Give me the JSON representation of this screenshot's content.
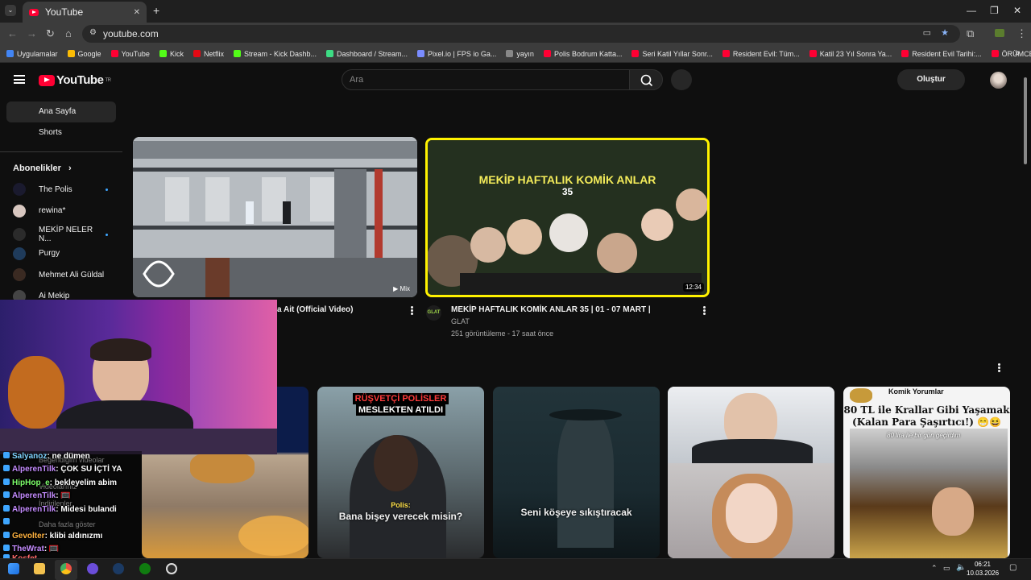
{
  "browser": {
    "tab_title": "YouTube",
    "new_tab": "+",
    "url": "youtube.com",
    "minimize": "—",
    "restore": "❐",
    "close": "✕",
    "bookmarks": [
      {
        "label": "Uygulamalar",
        "color": "#4285f4"
      },
      {
        "label": "Google",
        "color": "#fbbc05"
      },
      {
        "label": "YouTube",
        "color": "#ff0033"
      },
      {
        "label": "Kick",
        "color": "#53fc18"
      },
      {
        "label": "Netflix",
        "color": "#e50914"
      },
      {
        "label": "Stream - Kick Dashb...",
        "color": "#53fc18"
      },
      {
        "label": "Dashboard / Stream...",
        "color": "#3ddc84"
      },
      {
        "label": "Pixel.io | FPS io Ga...",
        "color": "#7a8cff"
      },
      {
        "label": "yayın",
        "color": "#888888"
      },
      {
        "label": "Polis Bodrum Katta...",
        "color": "#ff0033"
      },
      {
        "label": "Seri Katil Yıllar Sonr...",
        "color": "#ff0033"
      },
      {
        "label": "Resident Evil: Tüm...",
        "color": "#ff0033"
      },
      {
        "label": "Katil 23 Yıl Sonra Ya...",
        "color": "#ff0033"
      },
      {
        "label": "Resident Evil Tarihi:...",
        "color": "#ff0033"
      },
      {
        "label": "ÖRÜMCEK ADAM H...",
        "color": "#ff0033"
      }
    ]
  },
  "youtube": {
    "logo_text": "YouTube",
    "logo_sup": "TR",
    "search_placeholder": "Ara",
    "create_label": "Oluştur",
    "sidebar": {
      "home": "Ana Sayfa",
      "shorts": "Shorts",
      "subscriptions_header": "Abonelikler",
      "subscriptions": [
        {
          "name": "The Polis",
          "color": "#1a1a2e",
          "new": true
        },
        {
          "name": "rewina*",
          "color": "#d8c7c0",
          "new": false
        },
        {
          "name": "MEKİP NELER N...",
          "color": "#2b2b2b",
          "new": true
        },
        {
          "name": "Purgy",
          "color": "#1f3b5b",
          "new": false
        },
        {
          "name": "Mehmet Ali Güldal",
          "color": "#3a2a22",
          "new": false
        },
        {
          "name": "Ai Mekip",
          "color": "#444444",
          "new": false
        }
      ]
    },
    "videos": [
      {
        "title": "a Ait (Official Video)",
        "badge": "Mix"
      },
      {
        "title": "MEKİP HAFTALIK KOMİK ANLAR 35 | 01 - 07 MART |",
        "channel": "GLAT",
        "channel_badge": "GLAT",
        "meta": "251 görüntüleme - 17 saat önce",
        "duration": "12:34",
        "thumb_title_line1": "MEKİP HAFTALIK KOMİK ANLAR",
        "thumb_title_line2": "35"
      }
    ],
    "row2_thumbs": [
      {
        "line1": "RÜŞVETÇİ POLİSLER",
        "line2": "MESLEKTEN ATILDI",
        "label": "Polis:",
        "caption": "Bana bişey verecek misin?"
      },
      {
        "caption": "Seni köşeye sıkıştıracak"
      },
      {},
      {
        "header": "Komik Yorumlar",
        "line1": "80 TL ile Krallar Gibi Yaşamak",
        "line2": "(Kalan Para Şaşırtıcı!) 😁😆",
        "sub": "80 lira ile bir gün geçirdim"
      }
    ]
  },
  "overlay": {
    "menu_ghost": [
      "Beğendiğim videolar",
      "Videolarınız",
      "İndirilenler",
      "Daha fazla göster"
    ],
    "chat": [
      {
        "user": "Salyanoz",
        "msg": ": ne dümen",
        "color": "#7fd3ff"
      },
      {
        "user": "AlperenTilk",
        "msg": ": ÇOK SU İÇTİ YA",
        "color": "#c58cff"
      },
      {
        "user": "HipHop_e",
        "msg": ": bekleyelim abim",
        "color": "#7dff6a"
      },
      {
        "user": "AlperenTilk",
        "msg": ": 🥅",
        "color": "#c58cff"
      },
      {
        "user": "AlperenTilk",
        "msg": ": Midesi bulandi",
        "color": "#c58cff"
      },
      {
        "user": "",
        "msg": "",
        "color": "#ff6b6b"
      },
      {
        "user": "Gevolter",
        "msg": ": klibi aldınızmı",
        "color": "#ffb23f"
      },
      {
        "user": "TheWrat",
        "msg": ": 🥅",
        "color": "#c58cff"
      },
      {
        "user": "Kosfet",
        "msg": "",
        "color": "#ff6b6b"
      }
    ]
  },
  "taskbar": {
    "time": "06:21",
    "date": "10.03.2026"
  }
}
